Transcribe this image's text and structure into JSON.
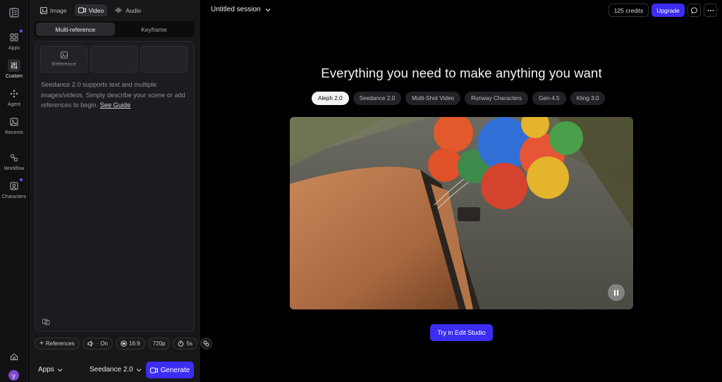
{
  "rail": {
    "items": [
      {
        "label": "Apps"
      },
      {
        "label": "Custom"
      },
      {
        "label": "Agent"
      },
      {
        "label": "Recents"
      },
      {
        "label": "Workflow"
      },
      {
        "label": "Characters"
      }
    ],
    "avatar_letter": "y"
  },
  "panel": {
    "mode_tabs": [
      {
        "label": "Image",
        "icon": "image-icon"
      },
      {
        "label": "Video",
        "icon": "video-icon"
      },
      {
        "label": "Audio",
        "icon": "audio-icon"
      }
    ],
    "active_mode": "Video",
    "sub_tabs": [
      {
        "label": "Multi-reference"
      },
      {
        "label": "Keyframe"
      }
    ],
    "reference_label": "Reference",
    "prompt_text": "Seedance 2.0 supports text and multiple images/videos. Simply describe your scene or add references to begin.",
    "see_guide": "See Guide",
    "chips": {
      "references": "References",
      "audio": "On",
      "aspect": "16:9",
      "resolution": "720p",
      "duration": "5s"
    },
    "apps_label": "Apps",
    "model_label": "Seedance 2.0",
    "generate_label": "Generate"
  },
  "header": {
    "session_title": "Untitled session",
    "credits": "125 credits",
    "upgrade": "Upgrade"
  },
  "main": {
    "headline": "Everything you need to make anything you want",
    "pills": [
      {
        "label": "Aleph 2.0"
      },
      {
        "label": "Seedance 2.0"
      },
      {
        "label": "Multi-Shot Video"
      },
      {
        "label": "Runway Characters"
      },
      {
        "label": "Gen-4.5"
      },
      {
        "label": "Kling 3.0"
      }
    ],
    "active_pill": "Aleph 2.0",
    "cta": "Try in Edit Studio"
  },
  "colors": {
    "accent": "#3b2df2",
    "background": "#000000",
    "panel": "#17171a"
  }
}
